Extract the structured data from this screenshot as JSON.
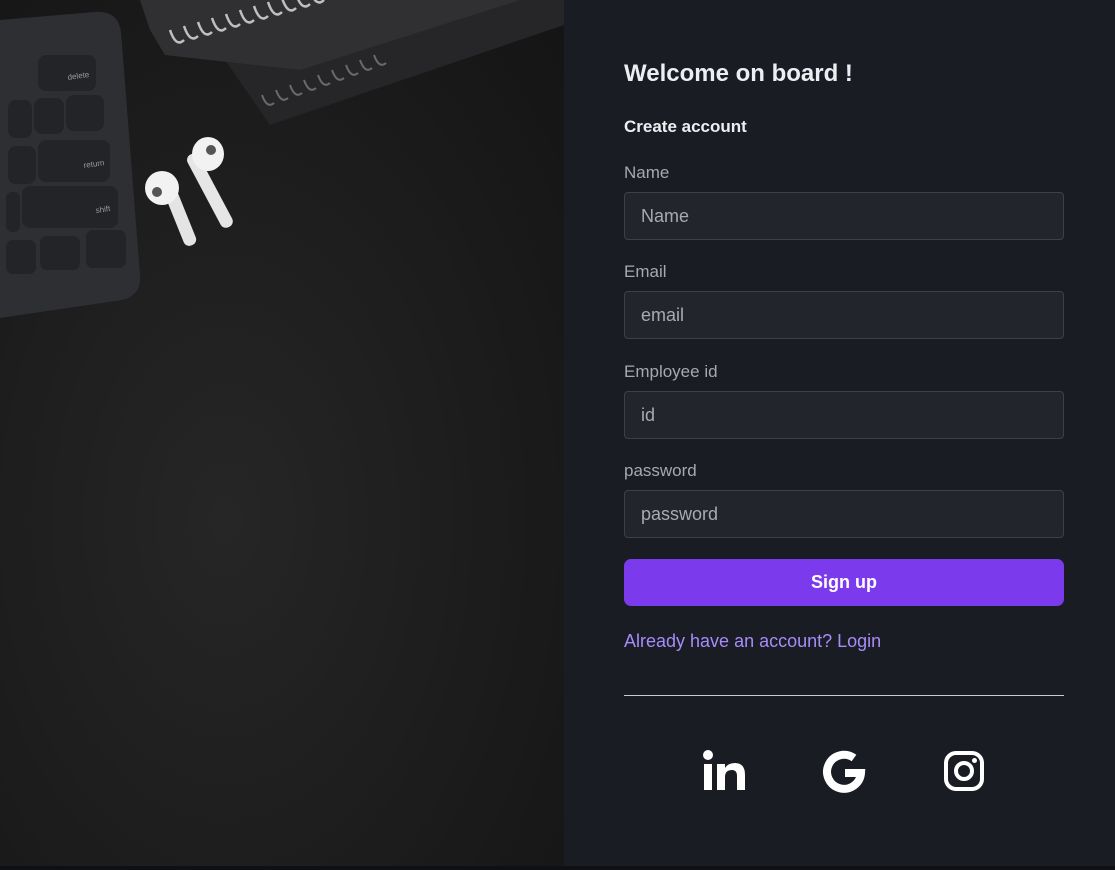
{
  "form": {
    "title": "Welcome on board !",
    "subtitle": "Create account",
    "fields": [
      {
        "label": "Name",
        "placeholder": "Name",
        "value": ""
      },
      {
        "label": "Email",
        "placeholder": "email",
        "value": ""
      },
      {
        "label": "Employee id",
        "placeholder": "id",
        "value": ""
      },
      {
        "label": "password",
        "placeholder": "password",
        "value": ""
      }
    ],
    "submit_label": "Sign up",
    "login_link": "Already have an account? Login"
  },
  "photo": {
    "keys": {
      "delete": "delete",
      "return": "return",
      "shift": "shift"
    }
  },
  "social": [
    {
      "icon": "linkedin-icon"
    },
    {
      "icon": "google-icon"
    },
    {
      "icon": "instagram-icon"
    }
  ],
  "colors": {
    "panel_background": "#1a1c23",
    "input_background": "#23252d",
    "input_border": "#3d404a",
    "accent": "#7c3aed",
    "link": "#a78bfa",
    "title_text": "#eceef2",
    "label_text": "#a5a8b3"
  }
}
